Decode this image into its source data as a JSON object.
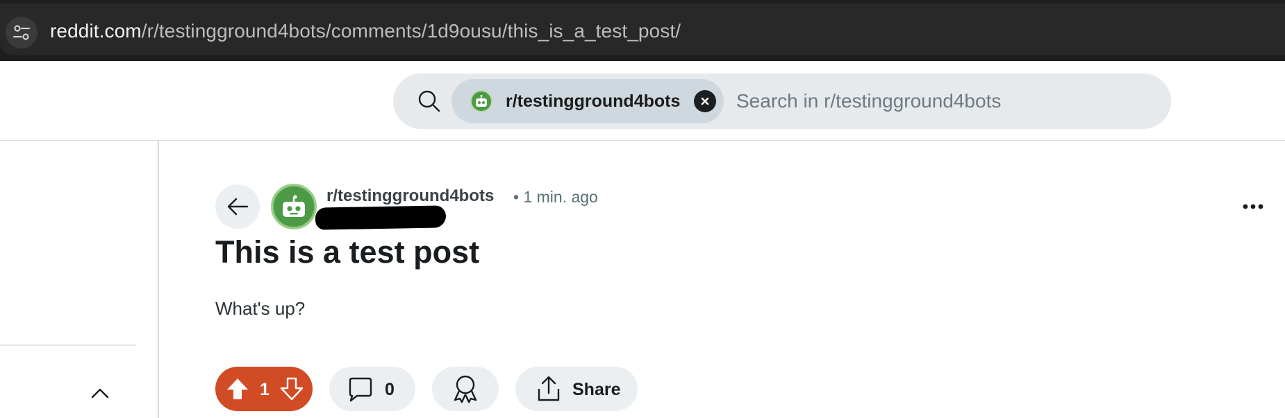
{
  "browser": {
    "url_host": "reddit.com",
    "url_path": "/r/testingground4bots/comments/1d9ousu/this_is_a_test_post/",
    "site_settings_icon": "tune-icon"
  },
  "header": {
    "search": {
      "icon": "search-icon",
      "chip_label": "r/testingground4bots",
      "chip_close_icon": "close-icon",
      "placeholder": "Search in r/testingground4bots",
      "value": ""
    }
  },
  "sidebar": {
    "collapse_icon": "chevron-up-icon"
  },
  "post": {
    "subreddit": "r/testingground4bots",
    "time": "• 1 min. ago",
    "title": "This is a test post",
    "body": "What's up?",
    "more_icon": "more-horizontal-icon",
    "back_icon": "arrow-left-icon"
  },
  "actions": {
    "votes": "1",
    "comments": "0",
    "share_label": "Share"
  },
  "colors": {
    "upvote_active": "#d14b24",
    "subreddit_avatar": "#4c9a46",
    "button_bg": "#eceff1"
  }
}
